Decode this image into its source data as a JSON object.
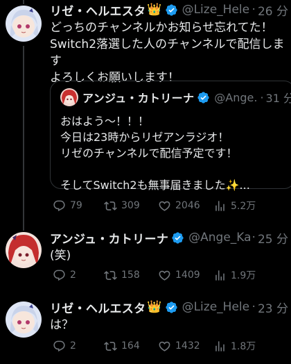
{
  "posts": [
    {
      "display_name": "リゼ・ヘルエスタ",
      "crown_emoji": "👑",
      "handle": "@Lize_Hele...",
      "separator": "·",
      "time": "26 分",
      "text": "どっちのチャンネルかお知らせ忘れてた！\nSwitch2落選した人のチャンネルで配信します\nよろしくお願いします！",
      "quote": {
        "display_name": "アンジュ・カトリーナ",
        "handle": "@Ange...",
        "separator": "·",
        "time": "31 分",
        "text": "おはよう～！！！\n今日は23時からリゼアンラジオ！\nリゼのチャンネルで配信予定です！\n\nそしてSwitch2も無事届きました✨..."
      },
      "actions": {
        "replies": "79",
        "reposts": "309",
        "likes": "2046",
        "views": "5.2万"
      }
    },
    {
      "display_name": "アンジュ・カトリーナ",
      "handle": "@Ange_Ka...",
      "separator": "·",
      "time": "25 分",
      "text": "(笑)",
      "actions": {
        "replies": "2",
        "reposts": "158",
        "likes": "1409",
        "views": "1.9万"
      }
    },
    {
      "display_name": "リゼ・ヘルエスタ",
      "crown_emoji": "👑",
      "handle": "@Lize_Hele...",
      "separator": "·",
      "time": "23 分",
      "text": "は？",
      "actions": {
        "replies": "2",
        "reposts": "164",
        "likes": "1432",
        "views": "1.8万"
      }
    }
  ],
  "colors": {
    "background": "#000000",
    "text": "#e7e9ea",
    "muted": "#71767b",
    "verified": "#1d9bf0",
    "border": "#2f3336"
  }
}
